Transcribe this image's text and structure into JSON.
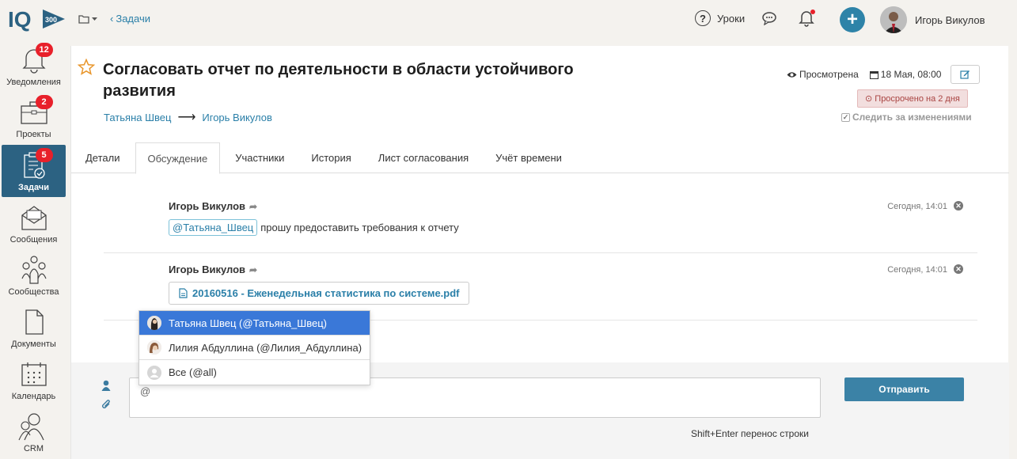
{
  "header": {
    "logo_text": "IQ",
    "logo_badge": "300",
    "back_label": "Задачи",
    "lessons_label": "Уроки",
    "user_name": "Игорь Викулов",
    "colors": {
      "accent": "#2e83a8",
      "notification_dot": "#e8202a"
    }
  },
  "sidebar": {
    "items": [
      {
        "label": "Уведомления",
        "icon": "bell-icon",
        "badge": "12"
      },
      {
        "label": "Проекты",
        "icon": "briefcase-icon",
        "badge": "2"
      },
      {
        "label": "Задачи",
        "icon": "clipboard-icon",
        "badge": "5",
        "active": true
      },
      {
        "label": "Сообщения",
        "icon": "envelope-icon"
      },
      {
        "label": "Сообщества",
        "icon": "community-icon"
      },
      {
        "label": "Документы",
        "icon": "document-icon"
      },
      {
        "label": "Календарь",
        "icon": "calendar-icon"
      },
      {
        "label": "CRM",
        "icon": "crm-icon"
      }
    ]
  },
  "task": {
    "title": "Согласовать отчет по деятельности в области устойчивого развития",
    "from": "Татьяна Швец",
    "to": "Игорь Викулов",
    "status": "Просмотрена",
    "date": "18 Мая, 08:00",
    "overdue": "Просрочено на 2 дня",
    "follow_label": "Следить за изменениями"
  },
  "tabs": [
    "Детали",
    "Обсуждение",
    "Участники",
    "История",
    "Лист согласования",
    "Учёт времени"
  ],
  "active_tab": "Обсуждение",
  "messages": [
    {
      "author": "Игорь Викулов",
      "time": "Сегодня, 14:01",
      "mention": "@Татьяна_Швец",
      "text": "прошу предоставить требования к отчету"
    },
    {
      "author": "Игорь Викулов",
      "time": "Сегодня, 14:01",
      "file": "20160516 - Еженедельная статистика по системе.pdf"
    }
  ],
  "mention_dropdown": [
    {
      "label": "Татьяна Швец (@Татьяна_Швец)",
      "selected": true
    },
    {
      "label": "Лилия Абдуллина (@Лилия_Абдуллина)"
    },
    {
      "label": "Все (@all)"
    }
  ],
  "composer": {
    "value": "@",
    "send_label": "Отправить",
    "hint": "Shift+Enter перенос строки"
  }
}
